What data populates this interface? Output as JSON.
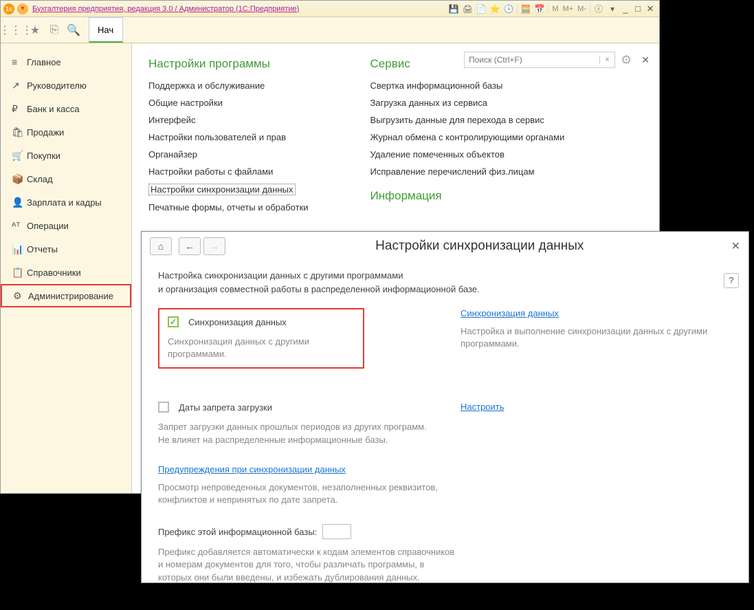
{
  "titlebar": {
    "title": "Бухгалтерия предприятия, редакция 3.0 / Администратор  (1С:Предприятие)",
    "m_btns": [
      "M",
      "M+",
      "M-"
    ]
  },
  "tab": {
    "label": "Нач"
  },
  "sidebar": [
    {
      "icon": "≡",
      "label": "Главное"
    },
    {
      "icon": "↗",
      "label": "Руководителю"
    },
    {
      "icon": "₽",
      "label": "Банк и касса"
    },
    {
      "icon": "🛍",
      "label": "Продажи"
    },
    {
      "icon": "🛒",
      "label": "Покупки"
    },
    {
      "icon": "📦",
      "label": "Склад"
    },
    {
      "icon": "👤",
      "label": "Зарплата и кадры"
    },
    {
      "icon": "ᴬᵀ",
      "label": "Операции"
    },
    {
      "icon": "📊",
      "label": "Отчеты"
    },
    {
      "icon": "📋",
      "label": "Справочники"
    },
    {
      "icon": "⚙",
      "label": "Администрирование"
    }
  ],
  "search": {
    "placeholder": "Поиск (Ctrl+F)"
  },
  "settings": {
    "heading": "Настройки программы",
    "items": [
      "Поддержка и обслуживание",
      "Общие настройки",
      "Интерфейс",
      "Настройки пользователей и прав",
      "Органайзер",
      "Настройки работы с файлами",
      "Настройки синхронизации данных",
      "Печатные формы, отчеты и обработки"
    ]
  },
  "service": {
    "heading": "Сервис",
    "items": [
      "Свертка информационной базы",
      "Загрузка данных из сервиса",
      "Выгрузить данные для перехода в сервис",
      "Журнал обмена с контролирующими органами",
      "Удаление помеченных объектов",
      "Исправление перечислений физ.лицам"
    ]
  },
  "info": {
    "heading": "Информация"
  },
  "dialog": {
    "title": "Настройки синхронизации данных",
    "desc1": "Настройка синхронизации данных с другими программами",
    "desc2": "и организация совместной работы в распределенной информационной базе.",
    "sync_chk": "Синхронизация данных",
    "sync_sub": "Синхронизация данных с другими программами.",
    "sync_link": "Синхронизация данных",
    "sync_link_sub": "Настройка и выполнение синхронизации данных с другими программами.",
    "dates_chk": "Даты запрета загрузки",
    "dates_link": "Настроить",
    "dates_sub1": "Запрет загрузки данных прошлых периодов из других программ.",
    "dates_sub2": "Не влияет на распределенные информационные базы.",
    "warn_link": "Предупреждения при синхронизации данных",
    "warn_sub1": "Просмотр непроведенных документов, незаполненных реквизитов,",
    "warn_sub2": "конфликтов и непринятых по дате запрета.",
    "prefix_label": "Префикс этой информационной базы:",
    "prefix_sub1": "Префикс добавляется автоматически к кодам элементов справочников",
    "prefix_sub2": "и номерам документов для того, чтобы различать программы, в",
    "prefix_sub3": "которых они были введены, и избежать дублирования данных."
  }
}
